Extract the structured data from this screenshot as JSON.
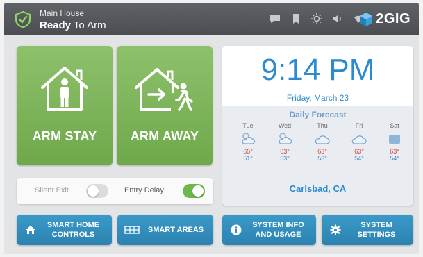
{
  "header": {
    "location": "Main House",
    "status_bold": "Ready",
    "status_rest": " To Arm",
    "brand": "2GIG",
    "icons": [
      "message-icon",
      "bookmark-icon",
      "brightness-icon",
      "volume-icon",
      "wifi-icon"
    ]
  },
  "arm": {
    "stay_label": "ARM STAY",
    "away_label": "ARM AWAY"
  },
  "options": {
    "silent_exit_label": "Silent Exit",
    "silent_exit_on": false,
    "entry_delay_label": "Entry Delay",
    "entry_delay_on": true
  },
  "clock": {
    "time": "9:14 PM",
    "date": "Friday, March 23"
  },
  "forecast": {
    "title": "Daily Forecast",
    "days": [
      {
        "name": "Tue",
        "icon": "partly-cloudy-icon",
        "hi": "65°",
        "lo": "51°"
      },
      {
        "name": "Wed",
        "icon": "partly-cloudy-icon",
        "hi": "63°",
        "lo": "53°"
      },
      {
        "name": "Thu",
        "icon": "cloudy-icon",
        "hi": "63°",
        "lo": "53°"
      },
      {
        "name": "Fri",
        "icon": "cloudy-icon",
        "hi": "63°",
        "lo": "54°"
      },
      {
        "name": "Sat",
        "icon": "overcast-icon",
        "hi": "63°",
        "lo": "54°"
      }
    ],
    "city": "Carlsbad, CA"
  },
  "buttons": {
    "smart_home": [
      "SMART HOME",
      "CONTROLS"
    ],
    "smart_areas": "SMART AREAS",
    "system_info": [
      "SYSTEM INFO",
      "AND USAGE"
    ],
    "system_settings": [
      "SYSTEM",
      "SETTINGS"
    ]
  },
  "colors": {
    "arm_green": "#7cb45a",
    "accent_blue": "#2a8bd0",
    "button_blue": "#3390bf",
    "toggle_on": "#6cb84a",
    "hi_temp": "#d24a3c",
    "lo_temp": "#4a86c2"
  }
}
